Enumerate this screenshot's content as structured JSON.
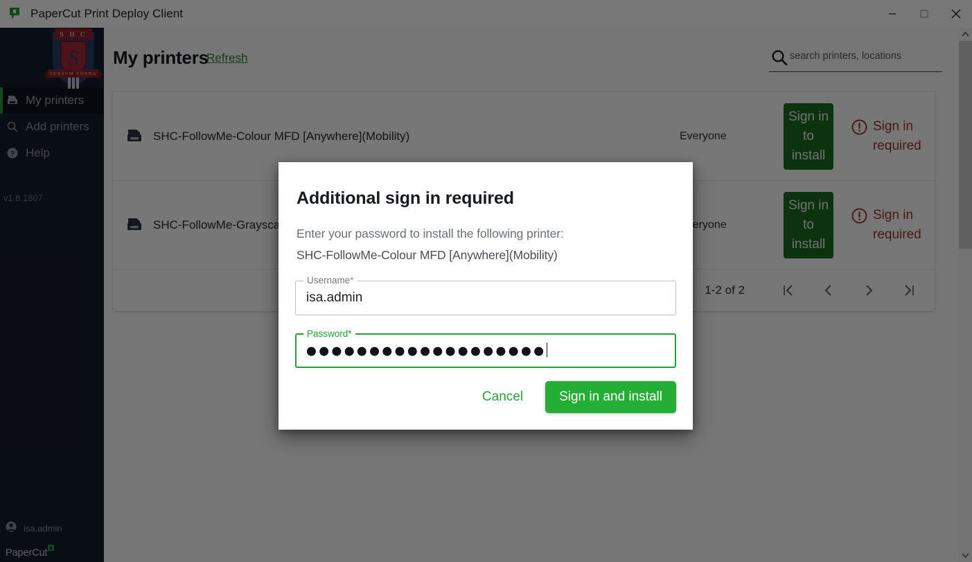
{
  "window": {
    "title": "PaperCut Print Deploy Client",
    "app_icon": "papercut-logo-icon",
    "minimize_label": "Minimize",
    "maximize_label": "Maximize",
    "close_label": "Close"
  },
  "sidebar": {
    "crest_alt": "SHC school crest, SURSUM CORDA",
    "crest_top_text": "S H C",
    "crest_motto": "SURSUM CORDA",
    "items": [
      {
        "label": "My printers",
        "icon": "printer-icon",
        "active": true
      },
      {
        "label": "Add printers",
        "icon": "search-icon",
        "active": false
      },
      {
        "label": "Help",
        "icon": "help-circle-icon",
        "active": false
      }
    ],
    "version": "v1.8.1807",
    "user": "isa.admin",
    "user_icon": "account-circle-icon",
    "brand": "PaperCut"
  },
  "header": {
    "title": "My printers",
    "refresh_label": "Refresh"
  },
  "search": {
    "placeholder": "search printers, locations",
    "value": "",
    "icon": "search-icon"
  },
  "table": {
    "rows": [
      {
        "icon": "printer-icon",
        "name": "SHC-FollowMe-Colour MFD [Anywhere](Mobility)",
        "shared_with": "Everyone",
        "action_label": "Sign in to install",
        "status_label": "Sign in required",
        "status_icon": "alert-circle-icon"
      },
      {
        "icon": "printer-icon",
        "name": "SHC-FollowMe-Grayscale MFD [Anywhere](Mobility)",
        "shared_with": "Everyone",
        "action_label": "Sign in to install",
        "status_label": "Sign in required",
        "status_icon": "alert-circle-icon"
      }
    ],
    "pagination": {
      "range_label": "1-2 of 2",
      "first_label": "First page",
      "prev_label": "Previous page",
      "next_label": "Next page",
      "last_label": "Last page"
    }
  },
  "dialog": {
    "title": "Additional sign in required",
    "subtitle": "Enter your password to install the following printer:",
    "printer_name": "SHC-FollowMe-Colour MFD [Anywhere](Mobility)",
    "username": {
      "label": "Username",
      "required_mark": "*",
      "value": "isa.admin"
    },
    "password": {
      "label": "Password",
      "required_mark": "*",
      "masked_value": "●●●●●●●●●●●●●●●●●●●",
      "focused": true
    },
    "cancel_label": "Cancel",
    "submit_label": "Sign in and install"
  },
  "colors": {
    "brand_green": "#25ae35",
    "install_green": "#1b6b22",
    "sidebar_bg": "#151d2b",
    "warn_red": "#9d2f2f",
    "accent_link": "#2c7d36"
  }
}
